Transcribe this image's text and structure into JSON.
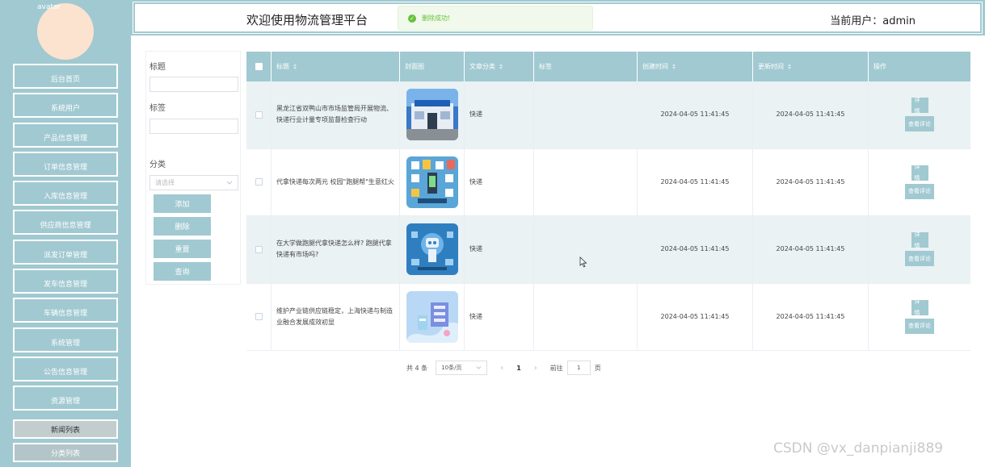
{
  "sidebar": {
    "avatar_alt": "avatar",
    "menu": [
      {
        "label": "后台首页"
      },
      {
        "label": "系统用户"
      },
      {
        "label": "产品信息管理"
      },
      {
        "label": "订单信息管理"
      },
      {
        "label": "入库信息管理"
      },
      {
        "label": "供应商信息管理"
      },
      {
        "label": "派发订单管理"
      },
      {
        "label": "发车信息管理"
      },
      {
        "label": "车辆信息管理"
      },
      {
        "label": "系统管理"
      },
      {
        "label": "公告信息管理"
      },
      {
        "label": "资源管理"
      }
    ],
    "submenu": [
      {
        "label": "新闻列表"
      },
      {
        "label": "分类列表"
      }
    ]
  },
  "header": {
    "title": "欢迎使用物流管理平台",
    "user": "当前用户：admin",
    "toast": "删除成功!",
    "toast_icon": "check-circle-icon"
  },
  "search": {
    "title_label": "标题",
    "tag_label": "标签",
    "category_label": "分类",
    "category_placeholder": "请选择",
    "buttons": {
      "add": "添加",
      "delete": "删除",
      "reset": "重置",
      "query": "查询"
    }
  },
  "table": {
    "headers": {
      "title": "标题",
      "cover": "封面图",
      "category": "文章分类",
      "tags": "标签",
      "created": "创建时间",
      "updated": "更新时间",
      "ops": "操作"
    },
    "rows": [
      {
        "title": "黑龙江省双鸭山市市场监管局开展物流、快递行业计量专项监督检查行动",
        "category": "快递",
        "tags": "",
        "created": "2024-04-05 11:41:45",
        "updated": "2024-04-05 11:41:45",
        "detail": "详情",
        "review": "查看评论"
      },
      {
        "title": "代拿快递每次两元 校园\"跑腿帮\"生意红火",
        "category": "快递",
        "tags": "",
        "created": "2024-04-05 11:41:45",
        "updated": "2024-04-05 11:41:45",
        "detail": "详情",
        "review": "查看评论"
      },
      {
        "title": "在大学做跑腿代拿快递怎么样? 跑腿代拿快递有市场吗?",
        "category": "快递",
        "tags": "",
        "created": "2024-04-05 11:41:45",
        "updated": "2024-04-05 11:41:45",
        "detail": "详情",
        "review": "查看评论"
      },
      {
        "title": "维护产业链供应链稳定，上海快递与制造业融合发展成效初显",
        "category": "快递",
        "tags": "",
        "created": "2024-04-05 11:41:45",
        "updated": "2024-04-05 11:41:45",
        "detail": "详情",
        "review": "查看评论"
      }
    ]
  },
  "pagination": {
    "total": "共 4 条",
    "page_size": "10条/页",
    "current": "1",
    "goto_prefix": "前往",
    "goto_value": "1",
    "goto_suffix": "页"
  },
  "watermark": "CSDN @vx_danpianji889",
  "colors": {
    "accent": "#a1c9d1",
    "toast_bg": "#f0f9eb",
    "toast_text": "#67c23a",
    "avatar": "#fbe3cf"
  }
}
